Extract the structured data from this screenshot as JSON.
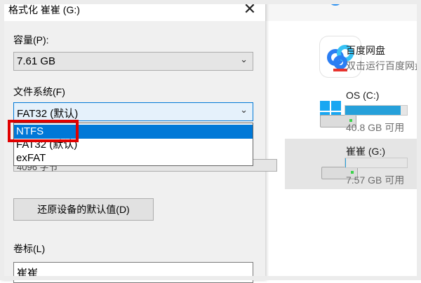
{
  "dialog": {
    "title": "格式化 崔崔 (G:)",
    "close_label": "✕",
    "capacity": {
      "label": "容量(P):",
      "value": "7.61 GB"
    },
    "file_system": {
      "label": "文件系统(F)",
      "value": "FAT32 (默认)",
      "options": [
        "NTFS",
        "FAT32 (默认)",
        "exFAT"
      ],
      "selected_index": 0
    },
    "allocation_unit_partial": "4096 字节",
    "restore_button": "还原设备的默认值(D)",
    "volume_label": {
      "label": "卷标(L)",
      "value": "崔崔"
    }
  },
  "explorer": {
    "baidu": {
      "name": "百度网盘",
      "subtitle": "双击运行百度网盘"
    },
    "os_drive": {
      "name": "OS (C:)",
      "free": "40.8 GB 可用",
      "used_fraction": 0.9
    },
    "g_drive": {
      "name": "崔崔 (G:)",
      "free": "7.57 GB 可用",
      "used_fraction": 0.01
    }
  },
  "colors": {
    "accent": "#0078d7",
    "annotation": "#e00000",
    "drive_bar": "#26a0da"
  },
  "icons": {
    "chevron": "chevron-down-icon",
    "baidu": "baidu-netdisk-icon",
    "windows": "windows-logo-icon",
    "hdd": "hard-drive-icon"
  }
}
